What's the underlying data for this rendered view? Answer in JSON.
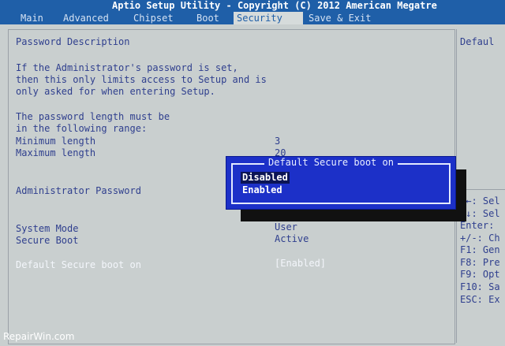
{
  "header": {
    "title": "Aptio Setup Utility - Copyright (C) 2012 American Megatre",
    "tabs": [
      "Main",
      "Advanced",
      "Chipset",
      "Boot",
      "Security",
      "Save & Exit"
    ],
    "active_tab": "Security"
  },
  "main": {
    "password_description": "Password Description",
    "desc_line1": "If the Administrator's password is set,",
    "desc_line2": "then this only limits access to Setup and is",
    "desc_line3": "only asked for when entering Setup.",
    "length_line1": "The password length must be",
    "length_line2": "in the following range:",
    "min_label": "Minimum length",
    "min_value": "3",
    "max_label": "Maximum length",
    "max_value": "20",
    "admin_password_label": "Administrator Password",
    "system_mode_label": "System Mode",
    "system_mode_value": "User",
    "secure_boot_label": "Secure Boot",
    "secure_boot_value": "Active",
    "default_secure_boot_label": "Default Secure boot on",
    "default_secure_boot_value": "[Enabled]"
  },
  "popup": {
    "title": "Default Secure boot on",
    "options": [
      "Disabled",
      "Enabled"
    ],
    "selected": "Disabled"
  },
  "right_panel": {
    "help_title": "Defaul",
    "keys": [
      "→←: Sel",
      "↑↓: Sel",
      "Enter:",
      "+/-: Ch",
      "F1: Gen",
      "F8: Pre",
      "F9: Opt",
      "F10: Sa",
      "ESC: Ex"
    ]
  },
  "footer": {
    "watermark": "RepairWin.com"
  },
  "colors": {
    "header_bg": "#1f5fa8",
    "body_bg": "#c9cfcf",
    "text": "#2f3f8e",
    "popup_bg": "#1c30c8"
  }
}
